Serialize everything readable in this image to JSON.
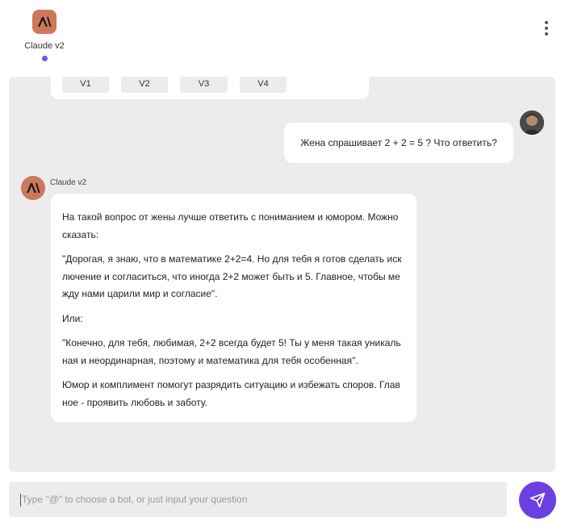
{
  "header": {
    "bot_tab_label": "Claude v2",
    "accent_color": "#7b4ee6",
    "menu_icon": "more-vertical-icon"
  },
  "versions": [
    "V1",
    "V2",
    "V3",
    "V4"
  ],
  "user_message": "Жена спрашивает 2 + 2 = 5 ? Что ответить?",
  "bot": {
    "name": "Claude v2",
    "paragraphs": [
      "На такой вопрос от жены лучше ответить с пониманием и юмором. Можно сказать:",
      "\"Дорогая, я знаю, что в математике 2+2=4. Но для тебя я готов сделать исключение и согласиться, что иногда 2+2 может быть и 5. Главное, чтобы между нами царили мир и согласие\".",
      "Или:",
      "\"Конечно, для тебя, любимая, 2+2 всегда будет 5! Ты у меня такая уникальная и неординарная, поэтому и математика для тебя особенная\".",
      "Юмор и комплимент помогут разрядить ситуацию и избежать споров. Главное - проявить любовь и заботу."
    ]
  },
  "input": {
    "placeholder": "Type \"@\" to choose a bot, or just input your question"
  },
  "colors": {
    "brand": "#cc785c",
    "send": "#6c3fe0",
    "chat_bg": "#ececec"
  }
}
